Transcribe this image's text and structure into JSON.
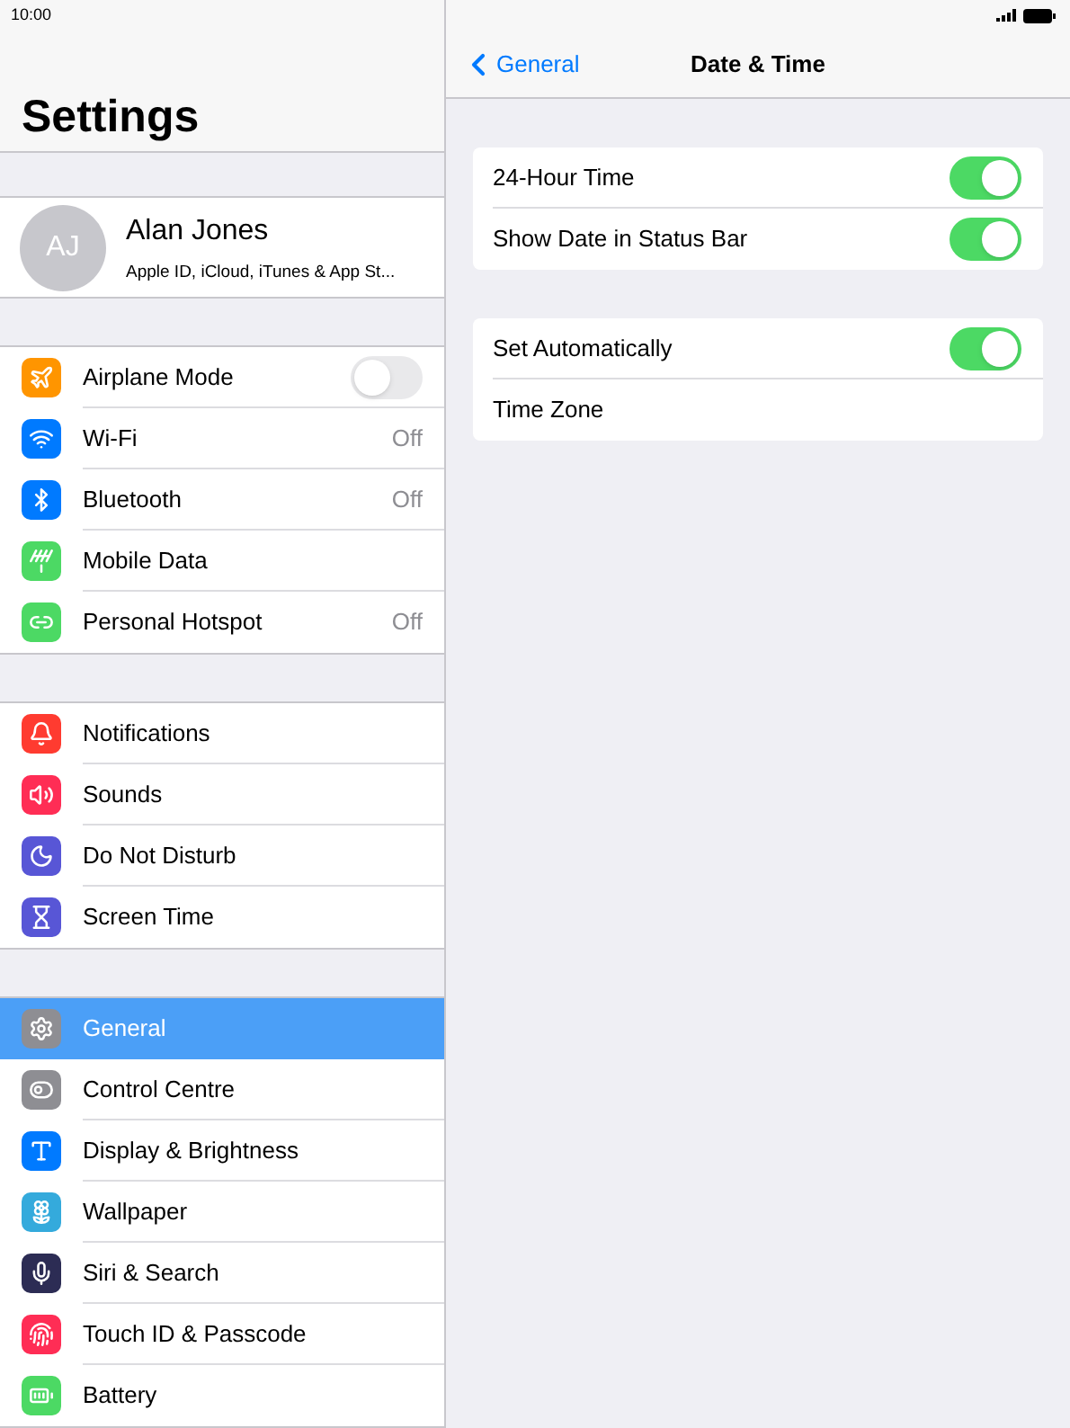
{
  "status_bar": {
    "time": "10:00"
  },
  "sidebar": {
    "title": "Settings",
    "profile": {
      "initials": "AJ",
      "name": "Alan Jones",
      "subtitle": "Apple ID, iCloud, iTunes & App St..."
    },
    "groups": [
      {
        "items": [
          {
            "label": "Airplane Mode",
            "kind": "toggle",
            "on": false,
            "color": "#ff9500",
            "selected": false
          },
          {
            "label": "Wi-Fi",
            "kind": "value",
            "value": "Off",
            "color": "#007aff",
            "selected": false
          },
          {
            "label": "Bluetooth",
            "kind": "value",
            "value": "Off",
            "color": "#007aff",
            "selected": false
          },
          {
            "label": "Mobile Data",
            "kind": "link",
            "color": "#4cd964",
            "selected": false
          },
          {
            "label": "Personal Hotspot",
            "kind": "value",
            "value": "Off",
            "color": "#4cd964",
            "selected": false
          }
        ]
      },
      {
        "items": [
          {
            "label": "Notifications",
            "kind": "link",
            "color": "#ff3b30",
            "selected": false
          },
          {
            "label": "Sounds",
            "kind": "link",
            "color": "#ff2d55",
            "selected": false
          },
          {
            "label": "Do Not Disturb",
            "kind": "link",
            "color": "#5856d6",
            "selected": false
          },
          {
            "label": "Screen Time",
            "kind": "link",
            "color": "#5856d6",
            "selected": false
          }
        ]
      },
      {
        "items": [
          {
            "label": "General",
            "kind": "link",
            "color": "#8e8e93",
            "selected": true
          },
          {
            "label": "Control Centre",
            "kind": "link",
            "color": "#8e8e93",
            "selected": false
          },
          {
            "label": "Display & Brightness",
            "kind": "link",
            "color": "#007aff",
            "selected": false
          },
          {
            "label": "Wallpaper",
            "kind": "link",
            "color": "#34aadc",
            "selected": false
          },
          {
            "label": "Siri & Search",
            "kind": "link",
            "color": "#2c2c54",
            "selected": false
          },
          {
            "label": "Touch ID & Passcode",
            "kind": "link",
            "color": "#ff2d55",
            "selected": false
          },
          {
            "label": "Battery",
            "kind": "link",
            "color": "#4cd964",
            "selected": false
          }
        ]
      }
    ]
  },
  "detail": {
    "back": "General",
    "title": "Date & Time",
    "groups": [
      {
        "rows": [
          {
            "label": "24-Hour Time",
            "kind": "toggle",
            "on": true
          },
          {
            "label": "Show Date in Status Bar",
            "kind": "toggle",
            "on": true
          }
        ]
      },
      {
        "rows": [
          {
            "label": "Set Automatically",
            "kind": "toggle",
            "on": true
          },
          {
            "label": "Time Zone",
            "kind": "link"
          }
        ]
      }
    ]
  }
}
